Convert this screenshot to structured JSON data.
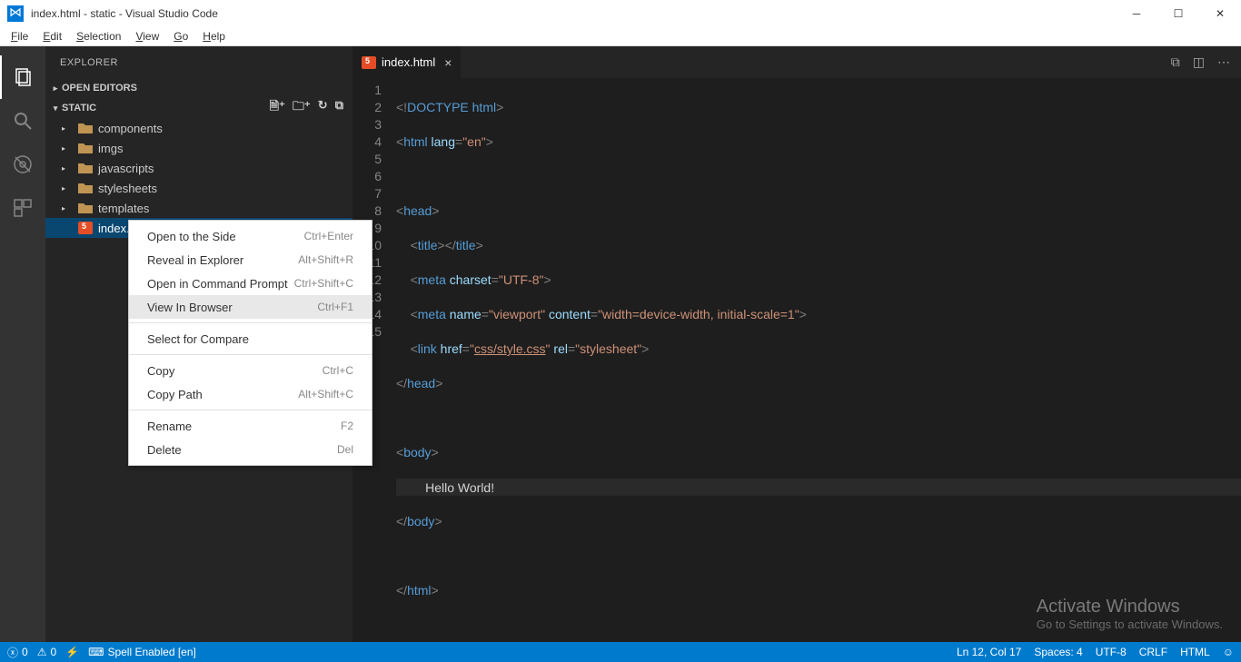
{
  "window": {
    "title": "index.html - static - Visual Studio Code"
  },
  "menubar": [
    "File",
    "Edit",
    "Selection",
    "View",
    "Go",
    "Help"
  ],
  "explorer": {
    "title": "EXPLORER",
    "sections": {
      "openEditors": "OPEN EDITORS",
      "project": "STATIC"
    },
    "folders": [
      "components",
      "imgs",
      "javascripts",
      "stylesheets",
      "templates"
    ],
    "file": "index.html"
  },
  "contextMenu": {
    "items": [
      {
        "label": "Open to the Side",
        "shortcut": "Ctrl+Enter"
      },
      {
        "label": "Reveal in Explorer",
        "shortcut": "Alt+Shift+R"
      },
      {
        "label": "Open in Command Prompt",
        "shortcut": "Ctrl+Shift+C"
      },
      {
        "label": "View In Browser",
        "shortcut": "Ctrl+F1",
        "hover": true
      }
    ],
    "group2": [
      {
        "label": "Select for Compare",
        "shortcut": ""
      }
    ],
    "group3": [
      {
        "label": "Copy",
        "shortcut": "Ctrl+C"
      },
      {
        "label": "Copy Path",
        "shortcut": "Alt+Shift+C"
      }
    ],
    "group4": [
      {
        "label": "Rename",
        "shortcut": "F2"
      },
      {
        "label": "Delete",
        "shortcut": "Del"
      }
    ]
  },
  "tab": {
    "name": "index.html"
  },
  "code": {
    "lines": 15,
    "content": {
      "l12_text": "        Hello World!"
    },
    "css_href": "css/style.css"
  },
  "statusbar": {
    "errors": "0",
    "warnings": "0",
    "spell": "Spell Enabled [en]",
    "pos": "Ln 12, Col 17",
    "spaces": "Spaces: 4",
    "encoding": "UTF-8",
    "eol": "CRLF",
    "lang": "HTML"
  },
  "watermark": {
    "l1": "Activate Windows",
    "l2": "Go to Settings to activate Windows."
  }
}
